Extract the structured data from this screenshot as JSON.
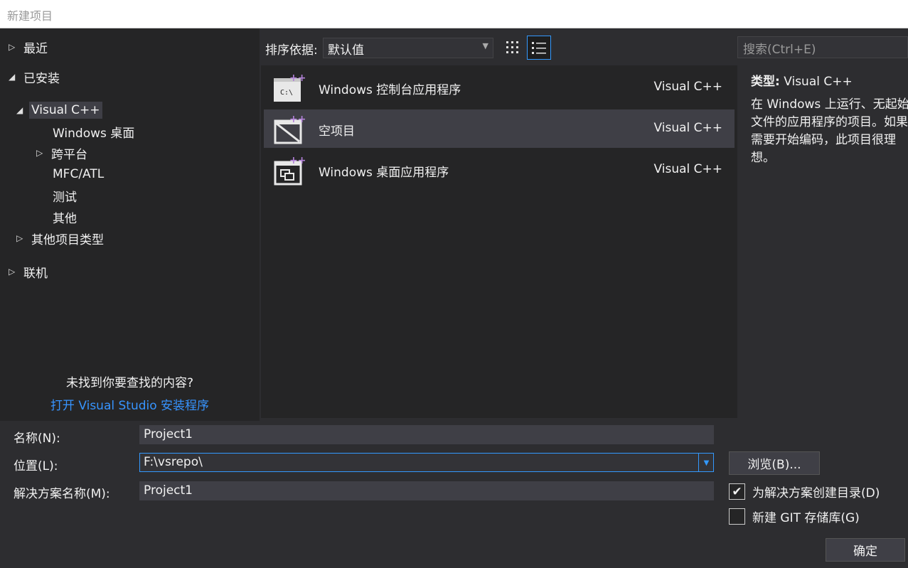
{
  "window": {
    "title": "新建项目"
  },
  "tree": {
    "recent": "最近",
    "installed": "已安装",
    "visual_cpp": "Visual C++",
    "windows_desktop": "Windows 桌面",
    "cross_platform": "跨平台",
    "mfc_atl": "MFC/ATL",
    "test": "测试",
    "other": "其他",
    "other_project_types": "其他项目类型",
    "online": "联机",
    "not_found": "未找到你要查找的内容?",
    "open_installer": "打开 Visual Studio 安装程序"
  },
  "sort": {
    "label": "排序依据:",
    "value": "默认值"
  },
  "templates": [
    {
      "name": "Windows 控制台应用程序",
      "lang": "Visual C++",
      "icon": "console-app-icon",
      "badge": "C:\\"
    },
    {
      "name": "空项目",
      "lang": "Visual C++",
      "icon": "empty-project-icon"
    },
    {
      "name": "Windows 桌面应用程序",
      "lang": "Visual C++",
      "icon": "desktop-app-icon"
    }
  ],
  "search": {
    "placeholder": "搜索(Ctrl+E)"
  },
  "description": {
    "type_label": "类型:",
    "type_value": "Visual C++",
    "text": "在 Windows 上运行、无起始文件的应用程序的项目。如果需要开始编码，此项目很理想。"
  },
  "form": {
    "name_label": "名称(N):",
    "name_value": "Project1",
    "location_label": "位置(L):",
    "location_value": "F:\\vsrepo\\",
    "solution_label": "解决方案名称(M):",
    "solution_value": "Project1",
    "browse": "浏览(B)...",
    "create_dir_label": "为解决方案创建目录(D)",
    "create_dir_checked": true,
    "create_git_label": "新建 GIT 存储库(G)",
    "create_git_checked": false,
    "ok": "确定"
  },
  "colors": {
    "background": "#2d2d30",
    "panel": "#252526",
    "selection": "#3f3f46",
    "accent": "#3399ff",
    "link": "#3794ff",
    "cpp_badge": "#b180d7"
  }
}
